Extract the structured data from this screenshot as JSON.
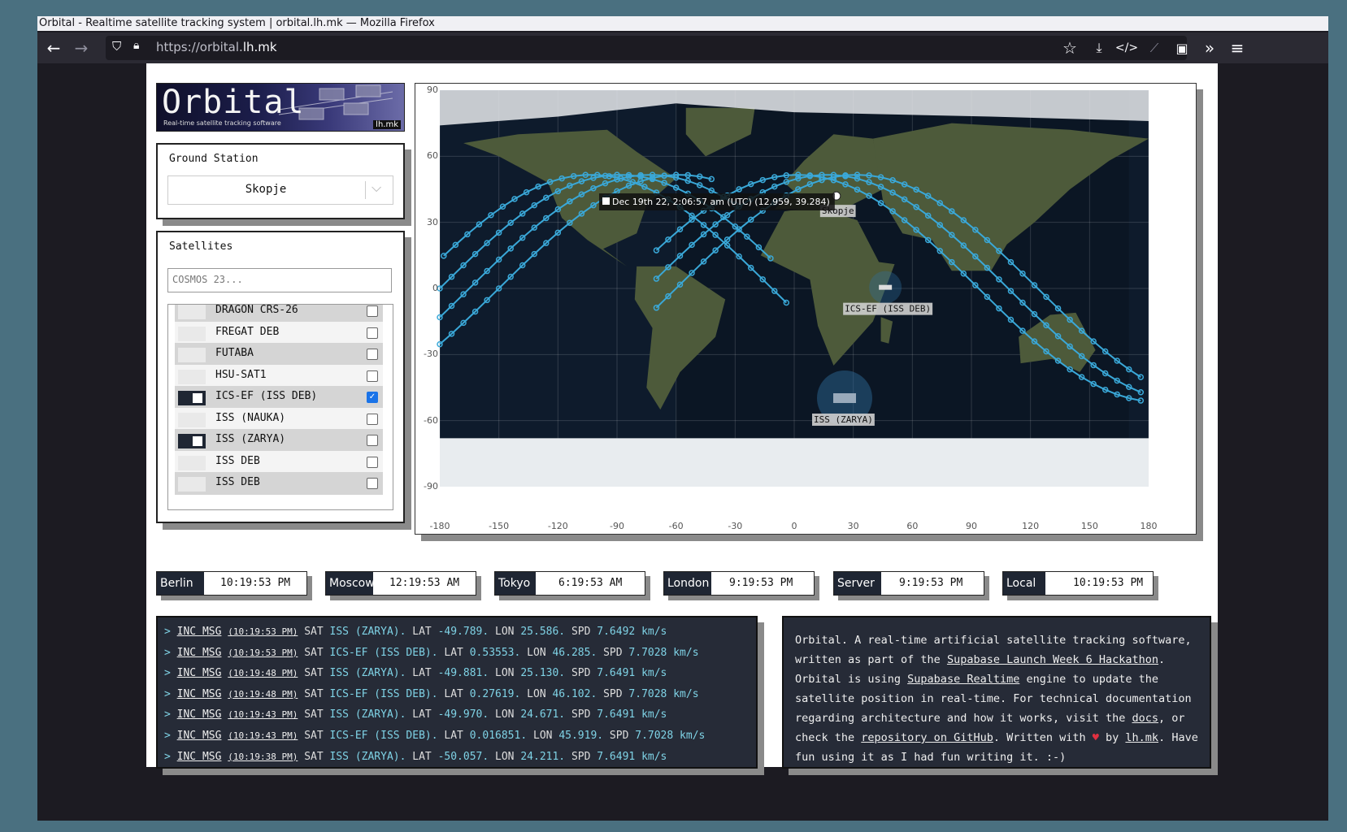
{
  "browser": {
    "window_title": "Orbital - Realtime satellite tracking system | orbital.lh.mk — Mozilla Firefox",
    "url_prefix": "https://orbital.",
    "url_domain": "lh.mk"
  },
  "logo": {
    "title": "Orbital",
    "subtitle": "Real-time satellite tracking software",
    "badge": "lh.mk"
  },
  "ground_station": {
    "label": "Ground Station",
    "selected": "Skopje"
  },
  "satellites": {
    "label": "Satellites",
    "search_placeholder": "COSMOS 23...",
    "items": [
      {
        "name": "DRAGON CRS-26",
        "on": false,
        "checked": false
      },
      {
        "name": "FREGAT DEB",
        "on": false,
        "checked": false
      },
      {
        "name": "FUTABA",
        "on": false,
        "checked": false
      },
      {
        "name": "HSU-SAT1",
        "on": false,
        "checked": false
      },
      {
        "name": "ICS-EF (ISS DEB)",
        "on": true,
        "checked": true
      },
      {
        "name": "ISS (NAUKA)",
        "on": false,
        "checked": false
      },
      {
        "name": "ISS (ZARYA)",
        "on": true,
        "checked": false
      },
      {
        "name": "ISS DEB",
        "on": false,
        "checked": false
      },
      {
        "name": "ISS DEB",
        "on": false,
        "checked": false
      }
    ]
  },
  "map": {
    "y_ticks": [
      "90",
      "60",
      "30",
      "0",
      "-30",
      "-60",
      "-90"
    ],
    "x_ticks": [
      "-180",
      "-150",
      "-120",
      "-90",
      "-60",
      "-30",
      "0",
      "30",
      "60",
      "90",
      "120",
      "150",
      "180"
    ],
    "tooltip": "Dec 19th 22, 2:06:57 am (UTC) (12.959, 39.284)",
    "label_station": "Skopje",
    "label_sat1": "ICS-EF (ISS DEB)",
    "label_sat2": "ISS (ZARYA)",
    "colors": {
      "track": "#3aa8d8",
      "ocean": "#0e1b2c"
    }
  },
  "clocks": [
    {
      "city": "Berlin",
      "time": "10:19:53 PM"
    },
    {
      "city": "Moscow",
      "time": "12:19:53 AM"
    },
    {
      "city": "Tokyo",
      "time": "6:19:53 AM"
    },
    {
      "city": "London",
      "time": "9:19:53 PM"
    },
    {
      "city": "Server",
      "time": "9:19:53 PM"
    },
    {
      "city": "Local",
      "time": "10:19:53 PM"
    }
  ],
  "log": {
    "prompt": ">",
    "msg": "INC MSG",
    "lines": [
      {
        "time": "(10:19:53 PM)",
        "sat": "ISS (ZARYA).",
        "lat": "-49.789.",
        "lon": "25.586.",
        "spd": "7.6492 km/s"
      },
      {
        "time": "(10:19:53 PM)",
        "sat": "ICS-EF (ISS DEB).",
        "lat": "0.53553.",
        "lon": "46.285.",
        "spd": "7.7028 km/s"
      },
      {
        "time": "(10:19:48 PM)",
        "sat": "ISS (ZARYA).",
        "lat": "-49.881.",
        "lon": "25.130.",
        "spd": "7.6491 km/s"
      },
      {
        "time": "(10:19:48 PM)",
        "sat": "ICS-EF (ISS DEB).",
        "lat": "0.27619.",
        "lon": "46.102.",
        "spd": "7.7028 km/s"
      },
      {
        "time": "(10:19:43 PM)",
        "sat": "ISS (ZARYA).",
        "lat": "-49.970.",
        "lon": "24.671.",
        "spd": "7.6491 km/s"
      },
      {
        "time": "(10:19:43 PM)",
        "sat": "ICS-EF (ISS DEB).",
        "lat": "0.016851.",
        "lon": "45.919.",
        "spd": "7.7028 km/s"
      },
      {
        "time": "(10:19:38 PM)",
        "sat": "ISS (ZARYA).",
        "lat": "-50.057.",
        "lon": "24.211.",
        "spd": "7.6491 km/s"
      }
    ]
  },
  "about": {
    "t1": "Orbital. A real-time artificial satellite tracking software, written as part of the ",
    "l1": "Supabase Launch Week 6 Hackathon",
    "t2": ". Orbital is using ",
    "l2": "Supabase Realtime",
    "t3": " engine to update the satellite position in real-time. For technical documentation regarding architecture and how it works, visit the ",
    "l3": "docs",
    "t4": ", or check the ",
    "l4": "repository on GitHub",
    "t5": ". Written with ",
    "heart": "♥",
    "t6": " by ",
    "l5": "lh.mk",
    "t7": ". Have fun using it as I had fun writing it. :-)"
  }
}
